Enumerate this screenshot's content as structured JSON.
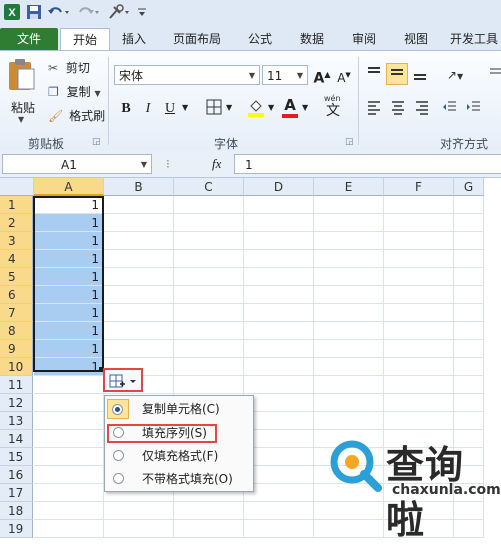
{
  "tabs": [
    "文件",
    "开始",
    "插入",
    "页面布局",
    "公式",
    "数据",
    "审阅",
    "视图",
    "开发工具"
  ],
  "clipboard": {
    "paste": "粘贴",
    "cut": "剪切",
    "copy": "复制",
    "format_painter": "格式刷",
    "group": "剪贴板"
  },
  "font": {
    "name": "宋体",
    "size": "11",
    "bold": "B",
    "italic": "I",
    "underline": "U",
    "group": "字体",
    "grow": "A",
    "shrink": "A",
    "color_letter": "A",
    "wen": "wén"
  },
  "alignment": {
    "group": "对齐方式"
  },
  "formula_bar": {
    "name_box": "A1",
    "fx": "fx",
    "value": "1"
  },
  "columns": [
    "A",
    "B",
    "C",
    "D",
    "E",
    "F",
    "G"
  ],
  "rows": [
    "1",
    "2",
    "3",
    "4",
    "5",
    "6",
    "7",
    "8",
    "9",
    "10",
    "11",
    "12",
    "13",
    "14",
    "15",
    "16",
    "17",
    "18",
    "19"
  ],
  "a_values": [
    "1",
    "1",
    "1",
    "1",
    "1",
    "1",
    "1",
    "1",
    "1",
    "1"
  ],
  "autofill_menu": [
    {
      "label": "复制单元格(C)",
      "selected": true
    },
    {
      "label": "填充序列(S)",
      "selected": false
    },
    {
      "label": "仅填充格式(F)",
      "selected": false
    },
    {
      "label": "不带格式填充(O)",
      "selected": false
    }
  ],
  "watermark": {
    "name": "查询啦",
    "url": "chaxunla.com"
  },
  "colors": {
    "file_tab": "#2f7d32",
    "selection": "#a9cdf0",
    "highlight": "#e04848",
    "logo": "#2aa0d6"
  }
}
